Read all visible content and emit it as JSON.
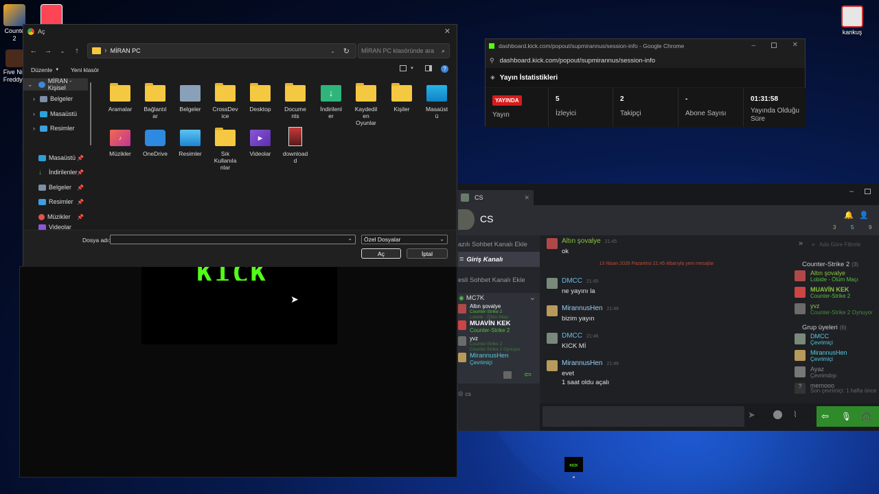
{
  "desktop": {
    "icons": [
      {
        "label": "Counte\n2"
      },
      {
        "label": "Five Nic\nFreddys"
      },
      {
        "label": "kankuş"
      }
    ]
  },
  "dialog": {
    "title": "Aç",
    "breadcrumb": "MİRAN PC",
    "search_placeholder": "MİRAN PC klasöründe ara",
    "organize": "Düzenle",
    "new_folder": "Yeni klasör",
    "tree": [
      {
        "label": "MİRAN - Kişisel"
      },
      {
        "label": "Belgeler"
      },
      {
        "label": "Masaüstü"
      },
      {
        "label": "Resimler"
      }
    ],
    "quick": [
      {
        "label": "Masaüstü"
      },
      {
        "label": "İndirilenler"
      },
      {
        "label": "Belgeler"
      },
      {
        "label": "Resimler"
      },
      {
        "label": "Müzikler"
      },
      {
        "label": "Videolar"
      }
    ],
    "folders": [
      {
        "label": "Aramalar",
        "icon": "folder-icon"
      },
      {
        "label": "Bağlantıl\nar",
        "icon": "folder-icon"
      },
      {
        "label": "Belgeler",
        "icon": "documents-folder-icon"
      },
      {
        "label": "CrossDev\nice",
        "icon": "folder-icon"
      },
      {
        "label": "Desktop",
        "icon": "folder-icon"
      },
      {
        "label": "Docume\nnts",
        "icon": "folder-icon"
      },
      {
        "label": "İndirilenl\ner",
        "icon": "downloads-folder-icon"
      },
      {
        "label": "Kaydedil\nen\nOyunlar",
        "icon": "folder-icon"
      },
      {
        "label": "Kişiler",
        "icon": "folder-icon"
      },
      {
        "label": "Masaüst\nü",
        "icon": "desktop-folder-icon"
      },
      {
        "label": "Müzikler",
        "icon": "music-folder-icon"
      },
      {
        "label": "OneDrive",
        "icon": "onedrive-icon"
      },
      {
        "label": "Resimler",
        "icon": "pictures-folder-icon"
      },
      {
        "label": "Sık\nKullanıla\nnlar",
        "icon": "folder-icon"
      },
      {
        "label": "Videolar",
        "icon": "videos-folder-icon"
      },
      {
        "label": "download\nd",
        "icon": "image-file-icon"
      }
    ],
    "filename_label": "Dosya adı:",
    "filename_value": "",
    "filter": "Özel Dosyalar",
    "open": "Aç",
    "cancel": "İptal"
  },
  "background_window": {
    "logo_text": "KICK"
  },
  "popup": {
    "url_title": "dashboard.kick.com/popout/supmirannus/session-info - Google Chrome",
    "url": "dashboard.kick.com/popout/supmirannus/session-info",
    "heading": "Yayın İstatistikleri",
    "stats": [
      {
        "value": "YAYINDA",
        "label": "Yayın"
      },
      {
        "value": "5",
        "label": "İzleyici"
      },
      {
        "value": "2",
        "label": "Takipçi"
      },
      {
        "value": "-",
        "label": "Abone Sayısı"
      },
      {
        "value": "01:31:58",
        "label": "Yayında Olduğu Süre"
      }
    ]
  },
  "chat": {
    "tab": "CS",
    "group_name": "CS",
    "counts": [
      "3",
      "5",
      "9"
    ],
    "left": {
      "voice_add": "azılı Sohbet Kanalı Ekle",
      "channel": "Giriş Kanalı",
      "voice_add2": "esli Sohbet Kanalı Ekle",
      "group": "MC7K",
      "members": [
        {
          "name": "Altın şovalye",
          "sub": "Counter-Strike 2",
          "sub2": "Lobide - Ölüm Maçı"
        },
        {
          "name": "MUAVİN KEK",
          "sub": "Counter-Strike 2"
        },
        {
          "name": "yvz",
          "sub": "Counter-Strike 2",
          "sub2": "Counter-Strike 2 Oynuyor"
        },
        {
          "name": "MirannusHen",
          "sub": "Çevrimiçi"
        }
      ],
      "footer": "cs"
    },
    "messages": [
      {
        "name": "Altın şovalye",
        "time": "21:45",
        "text": "ok"
      },
      {
        "divider": "13 Nisan 2026 Pazartesi 21:45 itibarıyla yeni mesajlar"
      },
      {
        "name": "DMCC",
        "time": "21:45",
        "text": "ne yayını la"
      },
      {
        "name": "MirannusHen",
        "time": "21:46",
        "text": "bizim yayın"
      },
      {
        "name": "DMCC",
        "time": "21:46",
        "text": "KICK Mİ"
      },
      {
        "name": "MirannusHen",
        "time": "21:46",
        "text": "evet",
        "text2": "1 saat oldu açalı"
      }
    ],
    "right": {
      "search": "Ada Göre Filtrele",
      "game_header": "Counter-Strike 2",
      "game_count": "(3)",
      "game_members": [
        {
          "name": "Altın şovalye",
          "sub": "Lobide - Ölüm Maçı"
        },
        {
          "name": "MUAVİN KEK",
          "sub": "Counter-Strike 2"
        },
        {
          "name": "yvz",
          "sub": "Counter-Strike 2 Oynuyor"
        }
      ],
      "group_header": "Grup üyeleri",
      "group_count": "(6)",
      "group_members": [
        {
          "name": "DMCC",
          "sub": "Çevrimiçi"
        },
        {
          "name": "MirannusHen",
          "sub": "Çevrimiçi"
        },
        {
          "name": "Ayaz",
          "sub": "Çevrimdışı"
        },
        {
          "name": "memooo",
          "sub": "Son çevrimiçi: 1 hafta önce"
        }
      ]
    }
  },
  "taskbar": {
    "kick_label": "KICK"
  }
}
